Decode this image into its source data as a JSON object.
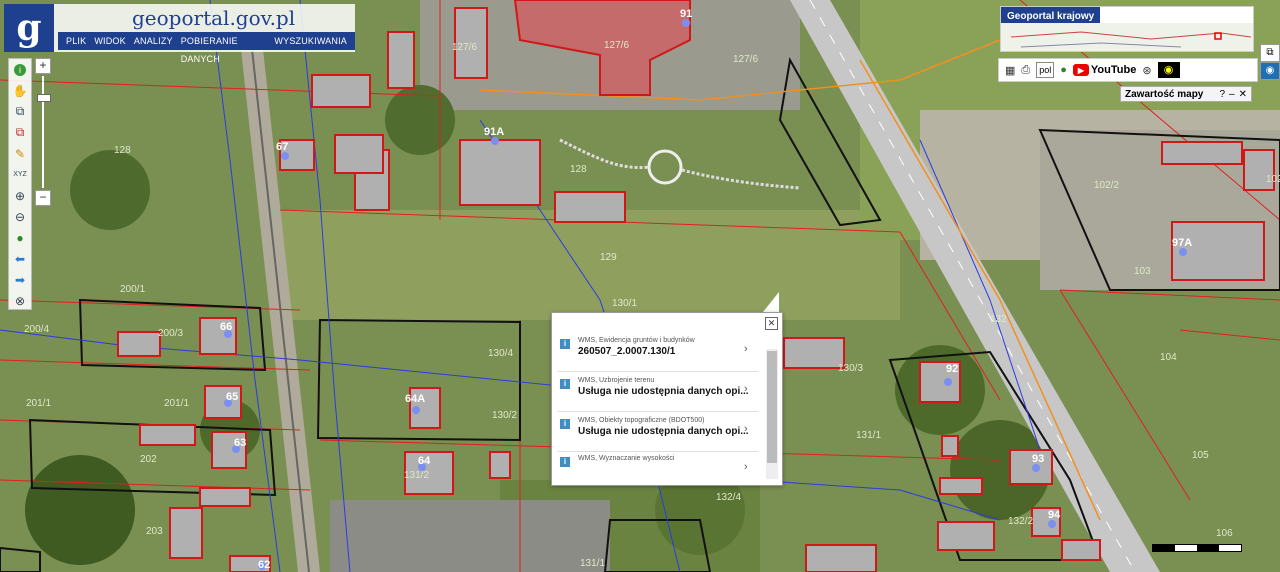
{
  "site": {
    "logo_letter": "g",
    "title": "geoportal.gov.pl"
  },
  "menu": [
    "PLIK",
    "WIDOK",
    "ANALIZY",
    "POBIERANIE DANYCH",
    "WYSZUKIWANIA"
  ],
  "overview": {
    "label": "Geoportal krajowy"
  },
  "toolbar_right": {
    "lang": "pol",
    "youtube": "YouTube"
  },
  "map_content": {
    "label": "Zawartość mapy"
  },
  "parcels": [
    "128",
    "127/6",
    "127/6",
    "127/6",
    "128",
    "129",
    "130/1",
    "130/4",
    "130/3",
    "130/2",
    "131/1",
    "131/2",
    "132/4",
    "132/2",
    "132",
    "131/1",
    "104",
    "105",
    "106",
    "102/2",
    "103",
    "102",
    "200/1",
    "200/4",
    "200/3",
    "201/1",
    "201/1",
    "202",
    "203"
  ],
  "addresses": [
    "91",
    "91A",
    "67",
    "66",
    "65",
    "64A",
    "64",
    "63",
    "62",
    "92",
    "93",
    "94",
    "97A"
  ],
  "popup": {
    "items": [
      {
        "source": "WMS, Ewidencja gruntów i budynków",
        "value": "260507_2.0007.130/1"
      },
      {
        "source": "WMS, Uzbrojenie terenu",
        "value": "Usługa nie udostępnia danych opi..."
      },
      {
        "source": "WMS, Obiekty topograficzne (BDOT500)",
        "value": "Usługa nie udostępnia danych opi..."
      },
      {
        "source": "WMS, Wyznaczanie wysokości",
        "value": ""
      }
    ]
  },
  "colors": {
    "brand": "#1f3f8f",
    "parcel_line": "#e02020",
    "building": "#d01818",
    "network": "#2a3ce0",
    "road": "#c7c7c7"
  }
}
